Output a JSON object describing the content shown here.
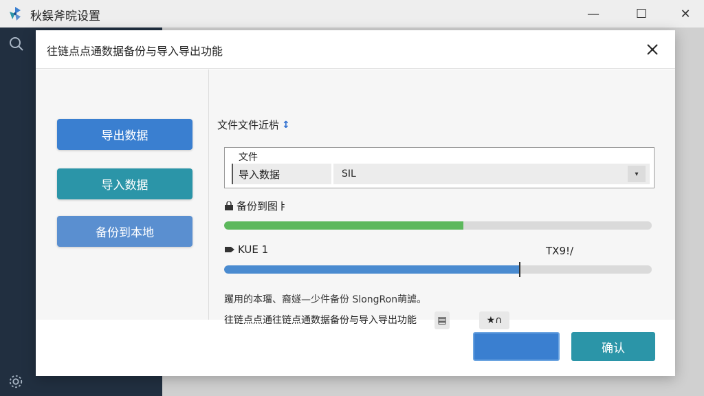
{
  "app": {
    "title": "秋鋘斧晥设置",
    "minimize_glyph": "—",
    "maximize_glyph": "☐",
    "close_glyph": "✕"
  },
  "dialog": {
    "title": "往链点点通数据备份与导入导出功能",
    "close_glyph": "✕"
  },
  "side_nav": {
    "items": [
      {
        "label": "导出数据",
        "color": "#3a7fd0"
      },
      {
        "label": "导入数据",
        "color": "#2b95a8"
      },
      {
        "label": "备份到本地",
        "color": "#5a8fd0"
      }
    ]
  },
  "content": {
    "section_label": "文件文件近㭊",
    "section_marker": "↕",
    "file_box": {
      "caption": "文件",
      "row_label": "导入数据",
      "select_value": "SIL",
      "arrow": "▾"
    },
    "progress1": {
      "label": "备份到图ㅑ",
      "icon": "folder-lock-icon",
      "percent": 56,
      "color": "#5cb85c"
    },
    "progress2": {
      "label": "KUE 1",
      "icon": "arrow-tag-icon",
      "right_text": "TX9!/",
      "percent": 69,
      "color": "#4a8bd0"
    },
    "note": "躩用的本璢、裔嬘—少件备份 SlongRon萌謔。",
    "footer_line": "往链点点通往链点通数据备份与导入导出功能",
    "footer_icon1": "▤",
    "footer_icon2": "★∩"
  },
  "footer": {
    "blank_button": "",
    "confirm_button": "确认",
    "blank_color": "#3a7fd0",
    "confirm_color": "#2b95a8"
  }
}
